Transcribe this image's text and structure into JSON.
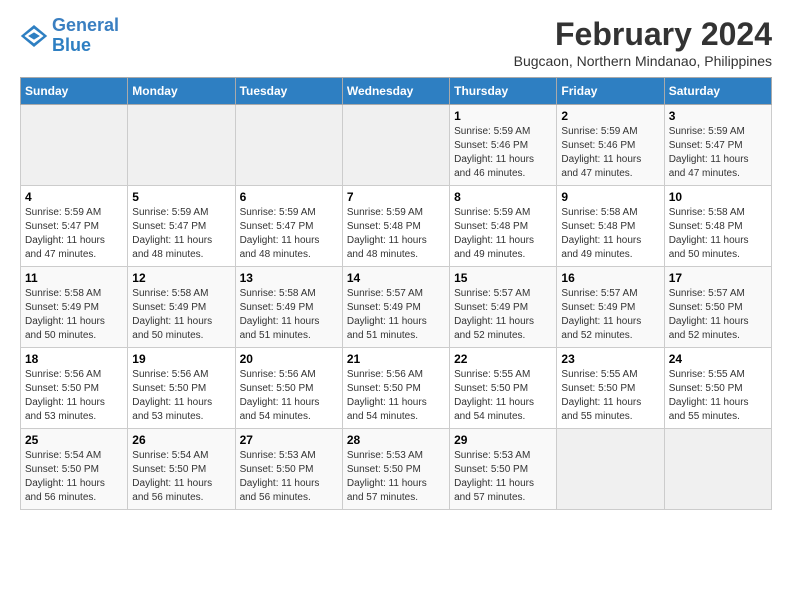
{
  "logo": {
    "line1": "General",
    "line2": "Blue"
  },
  "title": {
    "month_year": "February 2024",
    "location": "Bugcaon, Northern Mindanao, Philippines"
  },
  "headers": [
    "Sunday",
    "Monday",
    "Tuesday",
    "Wednesday",
    "Thursday",
    "Friday",
    "Saturday"
  ],
  "weeks": [
    [
      {
        "day": "",
        "info": ""
      },
      {
        "day": "",
        "info": ""
      },
      {
        "day": "",
        "info": ""
      },
      {
        "day": "",
        "info": ""
      },
      {
        "day": "1",
        "sunrise": "5:59 AM",
        "sunset": "5:46 PM",
        "daylight": "11 hours and 46 minutes."
      },
      {
        "day": "2",
        "sunrise": "5:59 AM",
        "sunset": "5:46 PM",
        "daylight": "11 hours and 47 minutes."
      },
      {
        "day": "3",
        "sunrise": "5:59 AM",
        "sunset": "5:47 PM",
        "daylight": "11 hours and 47 minutes."
      }
    ],
    [
      {
        "day": "4",
        "sunrise": "5:59 AM",
        "sunset": "5:47 PM",
        "daylight": "11 hours and 47 minutes."
      },
      {
        "day": "5",
        "sunrise": "5:59 AM",
        "sunset": "5:47 PM",
        "daylight": "11 hours and 48 minutes."
      },
      {
        "day": "6",
        "sunrise": "5:59 AM",
        "sunset": "5:47 PM",
        "daylight": "11 hours and 48 minutes."
      },
      {
        "day": "7",
        "sunrise": "5:59 AM",
        "sunset": "5:48 PM",
        "daylight": "11 hours and 48 minutes."
      },
      {
        "day": "8",
        "sunrise": "5:59 AM",
        "sunset": "5:48 PM",
        "daylight": "11 hours and 49 minutes."
      },
      {
        "day": "9",
        "sunrise": "5:58 AM",
        "sunset": "5:48 PM",
        "daylight": "11 hours and 49 minutes."
      },
      {
        "day": "10",
        "sunrise": "5:58 AM",
        "sunset": "5:48 PM",
        "daylight": "11 hours and 50 minutes."
      }
    ],
    [
      {
        "day": "11",
        "sunrise": "5:58 AM",
        "sunset": "5:49 PM",
        "daylight": "11 hours and 50 minutes."
      },
      {
        "day": "12",
        "sunrise": "5:58 AM",
        "sunset": "5:49 PM",
        "daylight": "11 hours and 50 minutes."
      },
      {
        "day": "13",
        "sunrise": "5:58 AM",
        "sunset": "5:49 PM",
        "daylight": "11 hours and 51 minutes."
      },
      {
        "day": "14",
        "sunrise": "5:57 AM",
        "sunset": "5:49 PM",
        "daylight": "11 hours and 51 minutes."
      },
      {
        "day": "15",
        "sunrise": "5:57 AM",
        "sunset": "5:49 PM",
        "daylight": "11 hours and 52 minutes."
      },
      {
        "day": "16",
        "sunrise": "5:57 AM",
        "sunset": "5:49 PM",
        "daylight": "11 hours and 52 minutes."
      },
      {
        "day": "17",
        "sunrise": "5:57 AM",
        "sunset": "5:50 PM",
        "daylight": "11 hours and 52 minutes."
      }
    ],
    [
      {
        "day": "18",
        "sunrise": "5:56 AM",
        "sunset": "5:50 PM",
        "daylight": "11 hours and 53 minutes."
      },
      {
        "day": "19",
        "sunrise": "5:56 AM",
        "sunset": "5:50 PM",
        "daylight": "11 hours and 53 minutes."
      },
      {
        "day": "20",
        "sunrise": "5:56 AM",
        "sunset": "5:50 PM",
        "daylight": "11 hours and 54 minutes."
      },
      {
        "day": "21",
        "sunrise": "5:56 AM",
        "sunset": "5:50 PM",
        "daylight": "11 hours and 54 minutes."
      },
      {
        "day": "22",
        "sunrise": "5:55 AM",
        "sunset": "5:50 PM",
        "daylight": "11 hours and 54 minutes."
      },
      {
        "day": "23",
        "sunrise": "5:55 AM",
        "sunset": "5:50 PM",
        "daylight": "11 hours and 55 minutes."
      },
      {
        "day": "24",
        "sunrise": "5:55 AM",
        "sunset": "5:50 PM",
        "daylight": "11 hours and 55 minutes."
      }
    ],
    [
      {
        "day": "25",
        "sunrise": "5:54 AM",
        "sunset": "5:50 PM",
        "daylight": "11 hours and 56 minutes."
      },
      {
        "day": "26",
        "sunrise": "5:54 AM",
        "sunset": "5:50 PM",
        "daylight": "11 hours and 56 minutes."
      },
      {
        "day": "27",
        "sunrise": "5:53 AM",
        "sunset": "5:50 PM",
        "daylight": "11 hours and 56 minutes."
      },
      {
        "day": "28",
        "sunrise": "5:53 AM",
        "sunset": "5:50 PM",
        "daylight": "11 hours and 57 minutes."
      },
      {
        "day": "29",
        "sunrise": "5:53 AM",
        "sunset": "5:50 PM",
        "daylight": "11 hours and 57 minutes."
      },
      {
        "day": "",
        "info": ""
      },
      {
        "day": "",
        "info": ""
      }
    ]
  ],
  "labels": {
    "sunrise": "Sunrise:",
    "sunset": "Sunset:",
    "daylight": "Daylight:"
  }
}
